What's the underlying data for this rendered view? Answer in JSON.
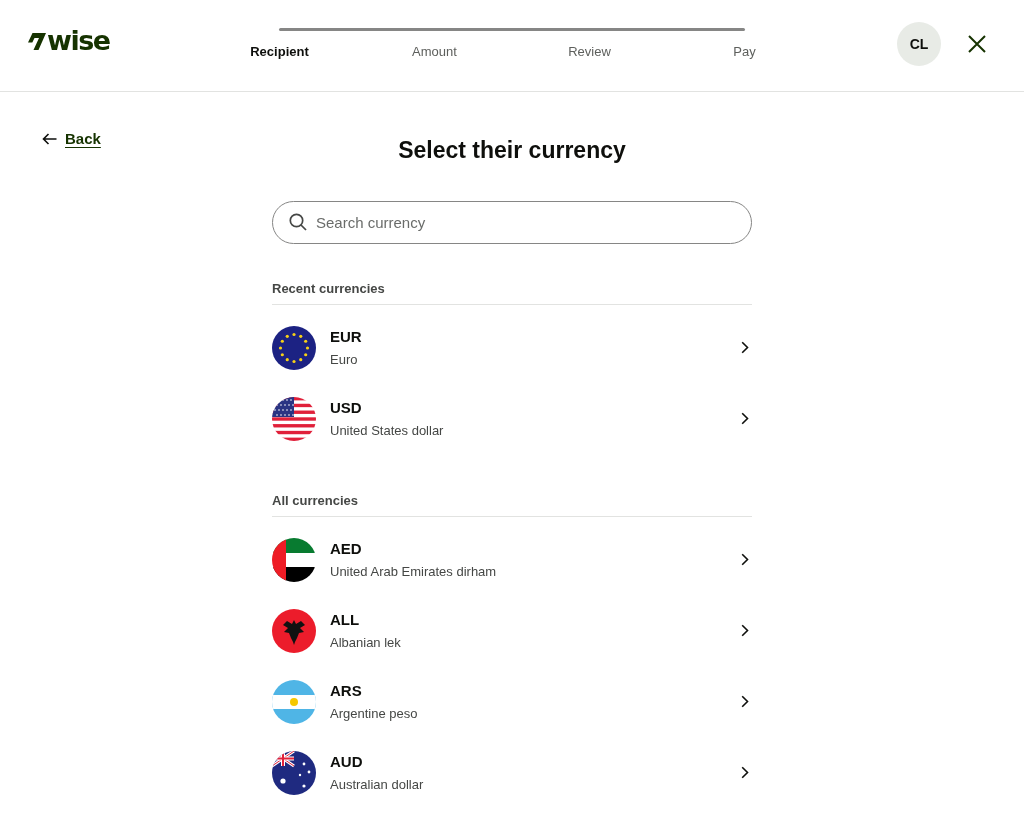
{
  "header": {
    "logo": "wise",
    "steps": [
      {
        "label": "Recipient",
        "selected": true
      },
      {
        "label": "Amount",
        "selected": false
      },
      {
        "label": "Review",
        "selected": false
      },
      {
        "label": "Pay",
        "selected": false
      }
    ],
    "avatar": "CL"
  },
  "back_link": "Back",
  "title": "Select their currency",
  "search": {
    "placeholder": "Search currency"
  },
  "sections": [
    {
      "heading": "Recent currencies",
      "currencies": [
        {
          "code": "EUR",
          "name": "Euro",
          "kind": "eu"
        },
        {
          "code": "USD",
          "name": "United States dollar",
          "kind": "us"
        }
      ]
    },
    {
      "heading": "All currencies",
      "currencies": [
        {
          "code": "AED",
          "name": "United Arab Emirates dirham",
          "kind": "ae"
        },
        {
          "code": "ALL",
          "name": "Albanian lek",
          "kind": "al"
        },
        {
          "code": "ARS",
          "name": "Argentine peso",
          "kind": "ar"
        },
        {
          "code": "AUD",
          "name": "Australian dollar",
          "kind": "au"
        }
      ]
    }
  ]
}
